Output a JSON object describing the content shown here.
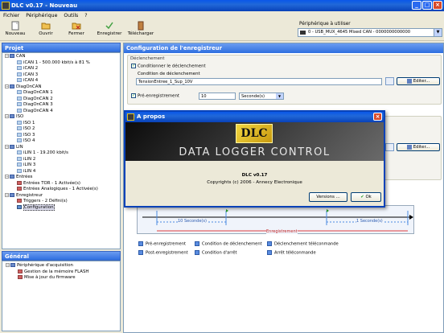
{
  "window": {
    "title": "DLC v0.17 - Nouveau"
  },
  "menubar": [
    "Fichier",
    "Périphérique",
    "Outils",
    "?"
  ],
  "toolbar": {
    "buttons": [
      "Nouveau",
      "Ouvrir",
      "Fermer",
      "Enregistrer",
      "Télécharger"
    ],
    "peripheral_label": "Périphérique à utiliser",
    "peripheral_value": "0 - USB_MUX_4645 Mixed CAN - 0000000000000"
  },
  "project": {
    "header": "Projet",
    "items": [
      {
        "label": "CAN",
        "level": 0,
        "type": "group"
      },
      {
        "label": "iCAN 1 - 500.000 kbit/s à 81 %",
        "level": 1,
        "type": "leaf"
      },
      {
        "label": "iCAN 2",
        "level": 1,
        "type": "leaf"
      },
      {
        "label": "iCAN 3",
        "level": 1,
        "type": "leaf"
      },
      {
        "label": "iCAN 4",
        "level": 1,
        "type": "leaf"
      },
      {
        "label": "DiagOnCAN",
        "level": 0,
        "type": "group"
      },
      {
        "label": "DiagOnCAN 1",
        "level": 1,
        "type": "leaf"
      },
      {
        "label": "DiagOnCAN 2",
        "level": 1,
        "type": "leaf"
      },
      {
        "label": "DiagOnCAN 3",
        "level": 1,
        "type": "leaf"
      },
      {
        "label": "DiagOnCAN 4",
        "level": 1,
        "type": "leaf"
      },
      {
        "label": "ISO",
        "level": 0,
        "type": "group"
      },
      {
        "label": "ISO 1",
        "level": 1,
        "type": "leaf"
      },
      {
        "label": "ISO 2",
        "level": 1,
        "type": "leaf"
      },
      {
        "label": "ISO 3",
        "level": 1,
        "type": "leaf"
      },
      {
        "label": "ISO 4",
        "level": 1,
        "type": "leaf"
      },
      {
        "label": "LIN",
        "level": 0,
        "type": "group"
      },
      {
        "label": "iLIN 1 - 19.200 kbit/s",
        "level": 1,
        "type": "leaf"
      },
      {
        "label": "iLIN 2",
        "level": 1,
        "type": "leaf"
      },
      {
        "label": "iLIN 3",
        "level": 1,
        "type": "leaf"
      },
      {
        "label": "iLIN 4",
        "level": 1,
        "type": "leaf"
      },
      {
        "label": "Entrées",
        "level": 0,
        "type": "group"
      },
      {
        "label": "Entrées TOR - 1 Activée(s)",
        "level": 1,
        "type": "in"
      },
      {
        "label": "Entrées Analogiques - 1 Activée(s)",
        "level": 1,
        "type": "in"
      },
      {
        "label": "Enregistreur",
        "level": 0,
        "type": "group"
      },
      {
        "label": "Triggers - 2 Défini(s)",
        "level": 1,
        "type": "in"
      },
      {
        "label": "Configuration",
        "level": 1,
        "type": "cfg"
      }
    ]
  },
  "general": {
    "header": "Général",
    "items": [
      {
        "label": "Périphérique d'acquisition",
        "level": 0
      },
      {
        "label": "Gestion de la mémoire FLASH",
        "level": 1
      },
      {
        "label": "Mise à jour du firmware",
        "level": 1
      }
    ]
  },
  "config": {
    "header": "Configuration de l'enregistreur",
    "trigger_group": "Déclenchement",
    "condition_checkbox": "Conditionner le déclenchement",
    "condition_label": "Condition de déclenchement",
    "condition_value": "TensionEntree_1_Sup_10V",
    "edit_button": "Editer...",
    "pretrigger_label": "Pré-enregistrement",
    "pretrigger_value": "10",
    "pretrigger_unit": "Seconde(s)",
    "edit_button_2": "Editer...",
    "timeline": {
      "left_label": "10 Seconde(s)",
      "right_label": "1 Seconde(s)",
      "rec_label": "Enregistrement"
    },
    "legend": [
      "Pré-enregistrement",
      "Condition de déclenchement",
      "Déclenchement téléconmande",
      "Post-enregistrement",
      "Condition d'arrêt",
      "Arrêt téléconmande"
    ]
  },
  "about": {
    "title": "A propos",
    "logo": "DLC",
    "banner": "DATA LOGGER CONTROL",
    "version": "DLC v0.17",
    "copyright": "Copyrights (c) 2006 - Annecy Electronique",
    "versions_button": "Versions ...",
    "ok_button": "Ok"
  }
}
